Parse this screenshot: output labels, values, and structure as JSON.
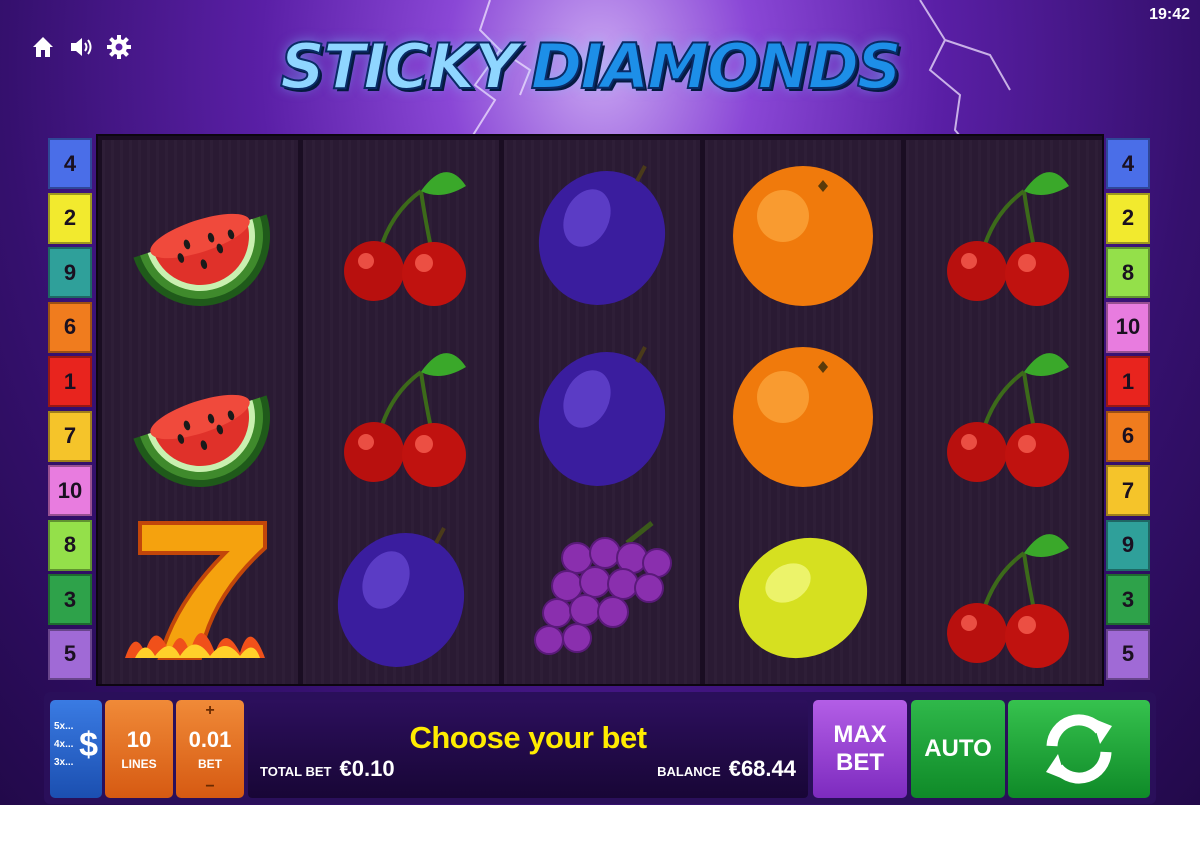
{
  "game": {
    "title_word1": "STICKY",
    "title_word2": "DIAMONDS",
    "clock": "19:42"
  },
  "top_icons": [
    "home-icon",
    "sound-icon",
    "settings-icon"
  ],
  "paylines": {
    "left": [
      "4",
      "2",
      "9",
      "6",
      "1",
      "7",
      "10",
      "8",
      "3",
      "5"
    ],
    "right": [
      "4",
      "2",
      "8",
      "10",
      "1",
      "6",
      "7",
      "9",
      "3",
      "5"
    ],
    "left_colors": [
      "#4a6ee8",
      "#f2ea2e",
      "#2fa09a",
      "#f07c1e",
      "#e8241e",
      "#f5c42a",
      "#e87cdf",
      "#94e04a",
      "#2ea24a",
      "#a06ad6"
    ],
    "right_colors": [
      "#4a6ee8",
      "#f2ea2e",
      "#94e04a",
      "#e87cdf",
      "#e8241e",
      "#f07c1e",
      "#f5c42a",
      "#2fa09a",
      "#2ea24a",
      "#a06ad6"
    ]
  },
  "reels": [
    [
      "watermelon",
      "watermelon",
      "seven"
    ],
    [
      "cherry",
      "cherry",
      "plum"
    ],
    [
      "plum",
      "plum",
      "grapes"
    ],
    [
      "orange",
      "orange",
      "lemon"
    ],
    [
      "cherry",
      "cherry",
      "cherry"
    ]
  ],
  "controls": {
    "multipliers": [
      "5x...",
      "4x...",
      "3x..."
    ],
    "dollar": "$",
    "lines_value": "10",
    "lines_label": "LINES",
    "bet_value": "0.01",
    "bet_label": "BET",
    "bet_plus": "+",
    "bet_minus": "−",
    "message": "Choose your bet",
    "total_bet_label": "TOTAL BET",
    "total_bet_value": "€0.10",
    "balance_label": "BALANCE",
    "balance_value": "€68.44",
    "max_bet_line1": "MAX",
    "max_bet_line2": "BET",
    "auto_label": "AUTO",
    "spin_icon": "refresh-icon"
  }
}
